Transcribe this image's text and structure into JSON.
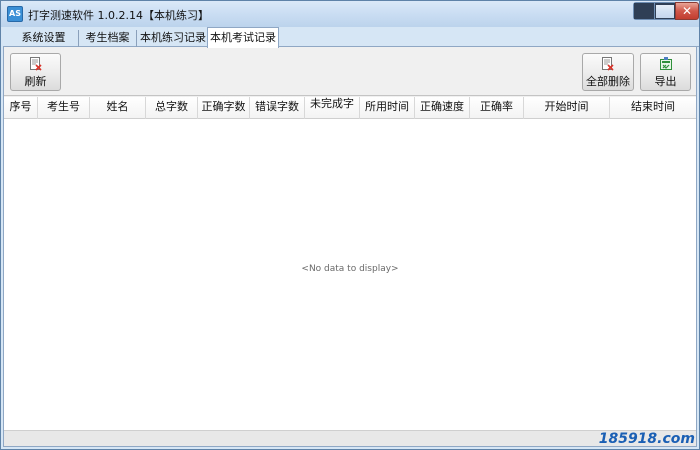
{
  "window": {
    "title": "打字测速软件 1.0.2.14【本机练习】",
    "icon": "app-logo-icon",
    "icon_text": "AS",
    "close_glyph": "✕"
  },
  "tabs": [
    {
      "label": "系统设置",
      "active": false
    },
    {
      "label": "考生档案",
      "active": false
    },
    {
      "label": "本机练习记录",
      "active": false
    },
    {
      "label": "本机考试记录",
      "active": true
    }
  ],
  "toolbar": {
    "refresh_label": "刷新",
    "delete_all_label": "全部删除",
    "export_label": "导出"
  },
  "grid": {
    "columns": [
      "序号",
      "考生号",
      "姓名",
      "总字数",
      "正确字数",
      "错误字数",
      "未完成字",
      "所用时间",
      "正确速度",
      "正确率",
      "开始时间",
      "结束时间"
    ],
    "rows": [],
    "empty_text": "<No data to display>"
  },
  "watermark": "185918.com",
  "colors": {
    "accent": "#3a8fd6",
    "close_button": "#c23d2f",
    "delete_icon": "#d9342b",
    "export_icon": "#2f8f3a"
  }
}
